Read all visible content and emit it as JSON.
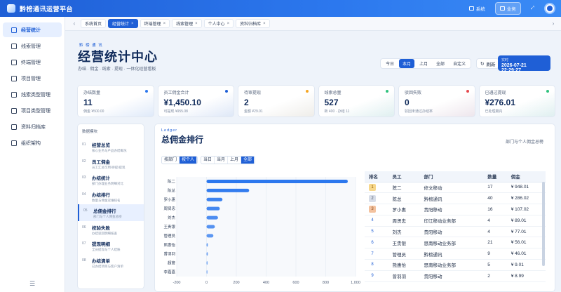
{
  "app": {
    "title": "黔榜通讯运营平台"
  },
  "topbar": {
    "system_label": "系统",
    "business_label": "业务"
  },
  "sidebar": {
    "items": [
      {
        "label": "经营统计",
        "active": true
      },
      {
        "label": "线索管理"
      },
      {
        "label": "终端管理"
      },
      {
        "label": "项目管理"
      },
      {
        "label": "线索类型管理"
      },
      {
        "label": "项目类型管理"
      },
      {
        "label": "资料归档库"
      },
      {
        "label": "组织架构"
      }
    ]
  },
  "tabs": [
    {
      "label": "系统首页",
      "closable": false
    },
    {
      "label": "经营统计",
      "closable": true,
      "active": true
    },
    {
      "label": "终端管理",
      "closable": true
    },
    {
      "label": "线索管理",
      "closable": true
    },
    {
      "label": "个人中心",
      "closable": true
    },
    {
      "label": "资料归档库",
      "closable": true
    }
  ],
  "hero": {
    "tag": "黔 榜 通 讯",
    "title": "经营统计中心",
    "subtitle": "办结 · 佣金 · 线索 · 提现 · 一体化经营看板",
    "ranges": [
      "今日",
      "本月",
      "上月",
      "全部",
      "自定义"
    ],
    "active_range": "本月",
    "refresh_label": "刷新",
    "date_label": "实时",
    "date_value": "2026-07-21 22:29:27"
  },
  "stats": [
    {
      "label": "办结数量",
      "value": "11",
      "sub": "佣金 ¥500.00",
      "color": "#2c78ee"
    },
    {
      "label": "员工佣金合计",
      "value": "¥1,450.10",
      "sub": "可提现 ¥955.08",
      "color": "#1f5fd6"
    },
    {
      "label": "待审提现",
      "value": "2",
      "sub": "金额 ¥29.01",
      "color": "#f5a623"
    },
    {
      "label": "线索总量",
      "value": "527",
      "sub": "新 400 · 办结 11",
      "color": "#2fc27d"
    },
    {
      "label": "驳回失败",
      "value": "0",
      "sub": "驳回未通过办结率",
      "color": "#e5484d"
    },
    {
      "label": "已通过提现",
      "value": "¥276.01",
      "sub": "已处理期内",
      "color": "#2fc27d"
    }
  ],
  "left_panel": {
    "title": "数据模块",
    "items": [
      {
        "num": "01",
        "name": "经营总览",
        "desc": "核心业务与产品办结概况"
      },
      {
        "num": "02",
        "name": "员工佣金",
        "desc": "员工汇总可用/待提/提现"
      },
      {
        "num": "03",
        "name": "办结统计",
        "desc": "部门办理业务明细对比"
      },
      {
        "num": "04",
        "name": "办结排行",
        "desc": "数量与佣金双维排名"
      },
      {
        "num": "05",
        "name": "总佣金排行",
        "desc": "部门与个人佣金总榜",
        "active": true
      },
      {
        "num": "06",
        "name": "校验失败",
        "desc": "办结驳回明细核查"
      },
      {
        "num": "07",
        "name": "提现明细",
        "desc": "全员提现与个人结账"
      },
      {
        "num": "08",
        "name": "办结清单",
        "desc": "已办结项目与客户清单"
      }
    ]
  },
  "ranking": {
    "tag": "Ledger",
    "title": "总佣金排行",
    "note": "部门与个人佣金总榜",
    "dim_buttons": [
      "按部门",
      "按个人"
    ],
    "active_dim": "按个人",
    "range_buttons": [
      "当日",
      "当月",
      "上月",
      "全部"
    ],
    "active_range": "全部",
    "table_headers": [
      "排名",
      "员工",
      "部门",
      "数量",
      "佣金"
    ],
    "rows": [
      {
        "rank": "1",
        "name": "陈二",
        "dept": "修文移动",
        "count": "17",
        "amount": "¥ 948.01"
      },
      {
        "rank": "2",
        "name": "陈总",
        "dept": "黔榜通讯",
        "count": "40",
        "amount": "¥ 286.02"
      },
      {
        "rank": "3",
        "name": "罗小惠",
        "dept": "贵阳移动",
        "count": "16",
        "amount": "¥ 107.02"
      },
      {
        "rank": "4",
        "name": "周贤忠",
        "dept": "印江移动业务部",
        "count": "4",
        "amount": "¥ 89.01"
      },
      {
        "rank": "5",
        "name": "刘杰",
        "dept": "贵阳移动",
        "count": "4",
        "amount": "¥ 77.01"
      },
      {
        "rank": "6",
        "name": "王贵银",
        "dept": "思南移动业务部",
        "count": "21",
        "amount": "¥ 56.01"
      },
      {
        "rank": "7",
        "name": "管理员",
        "dept": "黔榜通讯",
        "count": "9",
        "amount": "¥ 46.01"
      },
      {
        "rank": "8",
        "name": "熊惠怡",
        "dept": "思南移动业务部",
        "count": "5",
        "amount": "¥ 9.01"
      },
      {
        "rank": "9",
        "name": "曾羽羽",
        "dept": "贵阳移动",
        "count": "2",
        "amount": "¥ 8.99"
      }
    ]
  },
  "chart_data": {
    "type": "bar",
    "orientation": "horizontal",
    "categories": [
      "陈二",
      "陈总",
      "罗小惠",
      "周贤忠",
      "刘杰",
      "王贵银",
      "管理员",
      "熊惠怡",
      "曾羽羽",
      "超管",
      "李嘉嘉"
    ],
    "values": [
      948.01,
      286.02,
      107.02,
      89.01,
      77.01,
      56.01,
      46.01,
      9.01,
      8.99,
      7.5,
      6.5
    ],
    "xlim": [
      -200,
      1000
    ],
    "xticks": [
      -200,
      0,
      200,
      400,
      600,
      800,
      1000
    ],
    "xtick_labels": [
      "-200",
      "0",
      "200",
      "400",
      "600",
      "800",
      "1,000"
    ],
    "color": "#2c78ee",
    "grid": true
  }
}
